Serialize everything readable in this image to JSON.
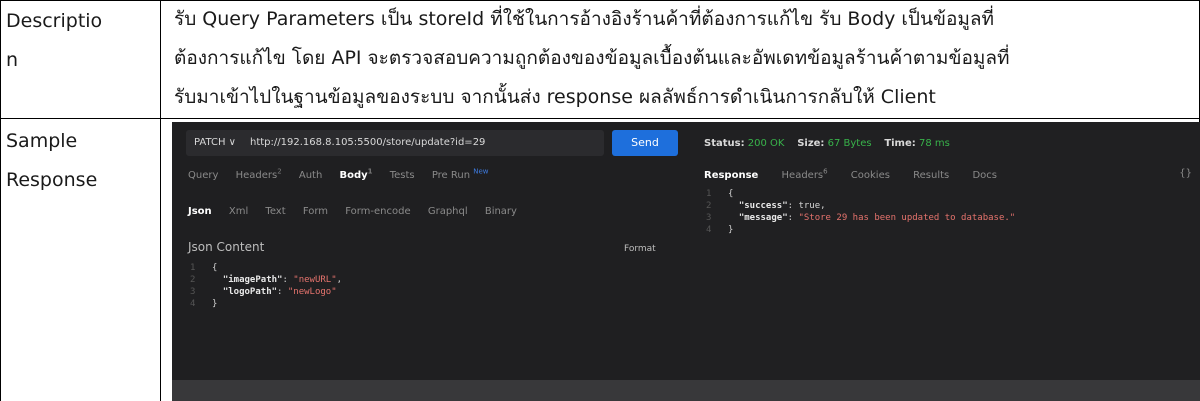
{
  "table": {
    "description_label_line1": "Descriptio",
    "description_label_line2": "n",
    "description_lines": [
      "รับ Query Parameters เป็น storeId ที่ใช้ในการอ้างอิงร้านค้าที่ต้องการแก้ไข รับ Body เป็นข้อมูลที่",
      "ต้องการแก้ไข โดย API จะตรวจสอบความถูกต้องของข้อมูลเบื้องต้นและอัพเดทข้อมูลร้านค้าตามข้อมูลที่",
      "รับมาเข้าไปในฐานข้อมูลของระบบ จากนั้นส่ง response ผลลัพธ์การดำเนินการกลับให้ Client"
    ],
    "sample_label_line1": "Sample",
    "sample_label_line2": "Response"
  },
  "request": {
    "method": "PATCH ∨",
    "url": "http://192.168.8.105:5500/store/update?id=29",
    "send_label": "Send",
    "tabs": [
      "Query",
      "Headers",
      "Auth",
      "Body",
      "Tests",
      "Pre Run"
    ],
    "headers_count": "2",
    "body_count": "1",
    "new_tag": "New",
    "body_types": [
      "Json",
      "Xml",
      "Text",
      "Form",
      "Form-encode",
      "Graphql",
      "Binary"
    ],
    "json_content_label": "Json Content",
    "format_label": "Format",
    "code_lines": [
      {
        "num": "1",
        "text": "{"
      },
      {
        "num": "2",
        "key": "\"imagePath\"",
        "value": "\"newURL\"",
        "trail": ","
      },
      {
        "num": "3",
        "key": "\"logoPath\"",
        "value": "\"newLogo\"",
        "trail": ""
      },
      {
        "num": "4",
        "text": "}"
      }
    ]
  },
  "response": {
    "status_label": "Status:",
    "status_value": "200 OK",
    "size_label": "Size:",
    "size_value": "67 Bytes",
    "time_label": "Time:",
    "time_value": "78 ms",
    "tabs": [
      "Response",
      "Headers",
      "Cookies",
      "Results",
      "Docs"
    ],
    "headers_count": "6",
    "braces": "{}",
    "code_lines": [
      {
        "num": "1",
        "text": "{"
      },
      {
        "num": "2",
        "key": "\"success\"",
        "value": "true",
        "trail": ","
      },
      {
        "num": "3",
        "key": "\"message\"",
        "value": "\"Store 29 has been updated to database.\"",
        "trail": ""
      },
      {
        "num": "4",
        "text": "}"
      }
    ]
  },
  "colors": {
    "accent_send": "#1e6fdc",
    "status_green": "#38b24a",
    "string_red": "#e5736d"
  }
}
